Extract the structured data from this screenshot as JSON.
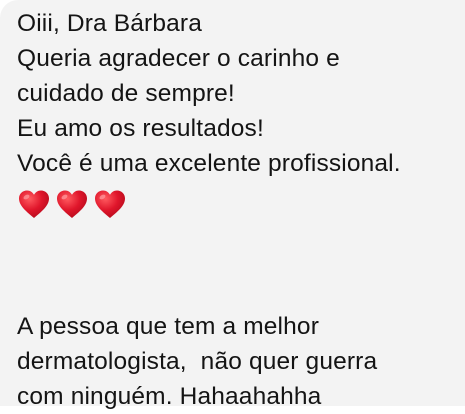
{
  "message": {
    "lines": [
      "Oiii, Dra Bárbara",
      "Queria agradecer o carinho e",
      "cuidado de sempre!",
      "Eu amo os resultados!",
      "Você é uma excelente profissional."
    ],
    "hearts": [
      "red-heart-icon",
      "red-heart-icon",
      "red-heart-icon"
    ],
    "heart_color": "#e0162b",
    "second_lines": [
      "A pessoa que tem a melhor",
      "dermatologista,  não quer guerra",
      "com ninguém. Hahaahahha"
    ]
  },
  "colors": {
    "bubble_bg": "#f3f3f3",
    "text": "#141414"
  }
}
